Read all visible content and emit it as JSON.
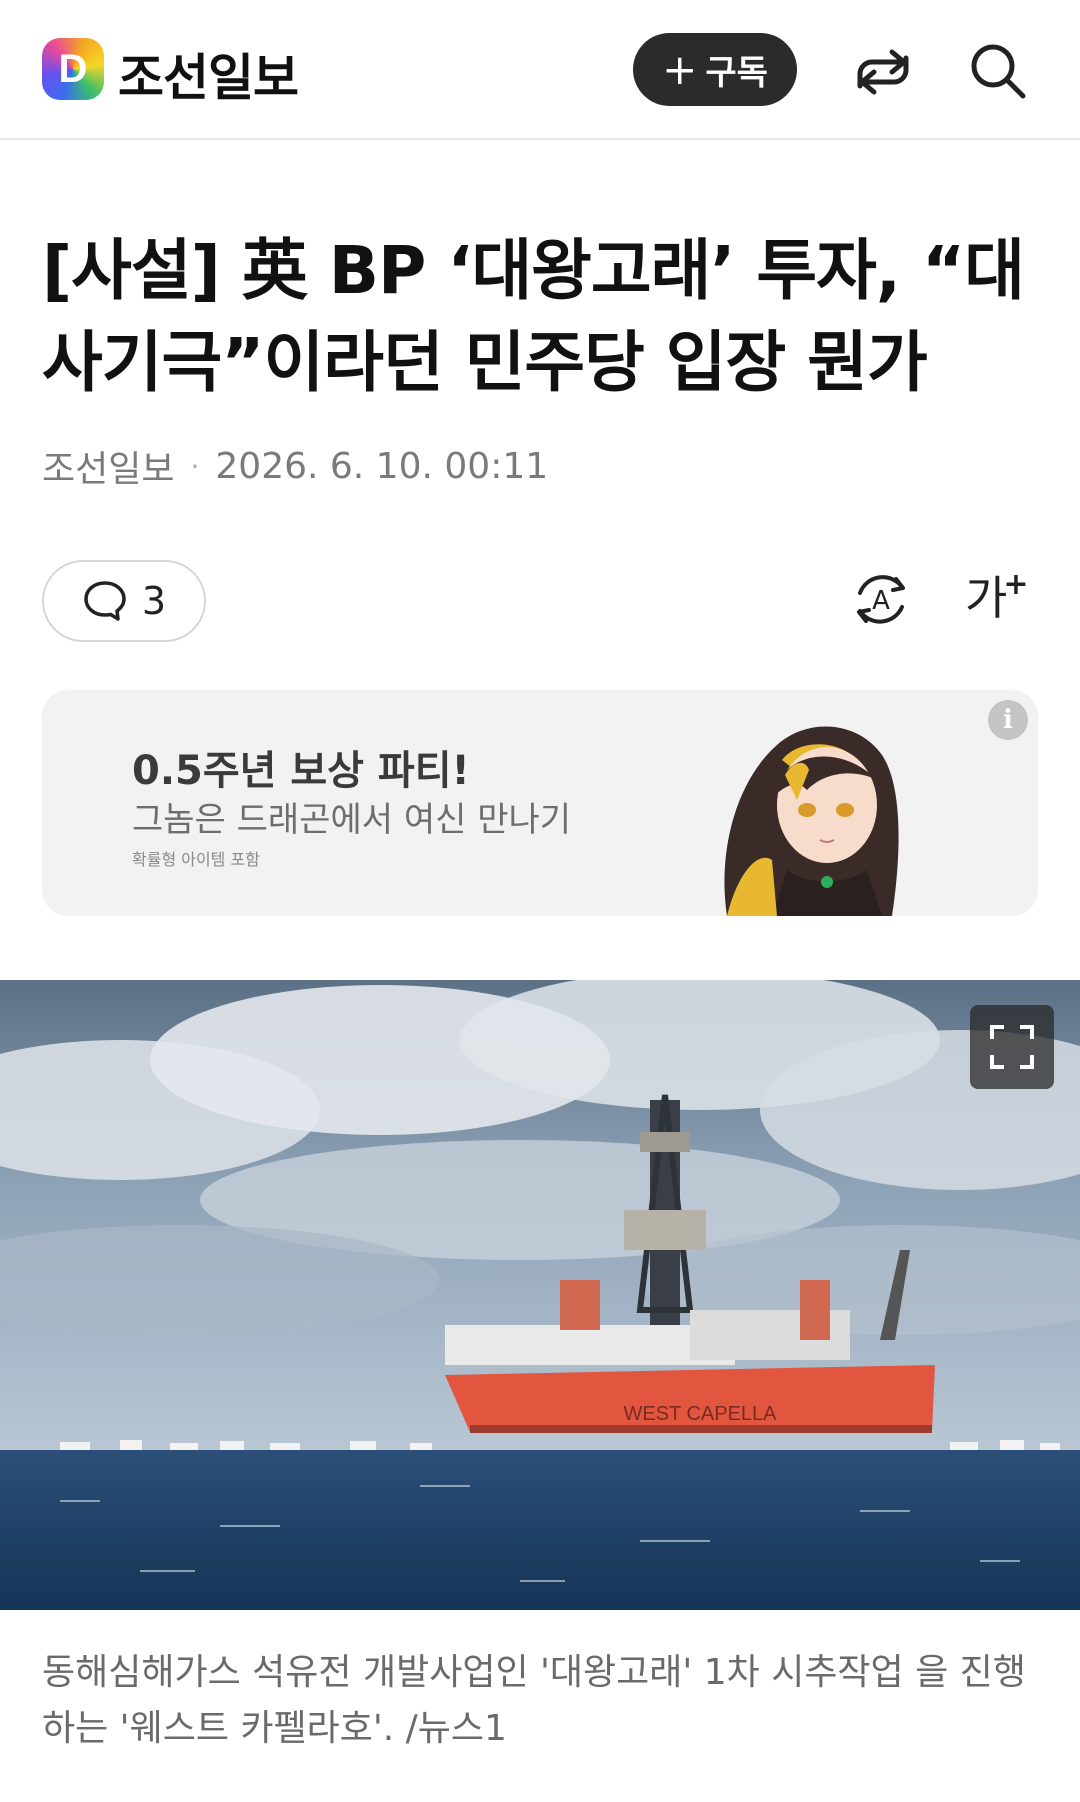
{
  "header": {
    "logo_letter": "D",
    "brand": "조선일보",
    "subscribe_plus": "+",
    "subscribe_label": "구독"
  },
  "article": {
    "headline": "[사설] 英 BP ‘대왕고래’ 투자, “대사기극”이라던 민주당 입장 뭔가",
    "source": "조선일보",
    "separator": "·",
    "datetime": "2026. 6. 10. 00:11",
    "comment_count": "3",
    "font_size_label": "가",
    "font_size_sup": "+",
    "translate_letter": "A"
  },
  "ad": {
    "title": "0.5주년 보상 파티!",
    "subtitle": "그놈은 드래곤에서 여신 만나기",
    "note": "확률형 아이템 포함",
    "info": "i"
  },
  "photo": {
    "ship_name": "WEST CAPELLA",
    "caption": "동해심해가스 석유전 개발사업인 '대왕고래' 1차 시추작업 을 진행하는 '웨스트 카펠라호'. /뉴스1"
  },
  "colors": {
    "accent_dark": "#2b2b2b",
    "text_primary": "#111111",
    "text_meta": "#7a7a7a",
    "ad_bg": "#f2f2f2",
    "hull": "#e2553f"
  },
  "icons": [
    "share-icon",
    "search-icon",
    "comment-icon",
    "translate-icon",
    "font-size-icon",
    "info-icon",
    "fullscreen-icon"
  ]
}
